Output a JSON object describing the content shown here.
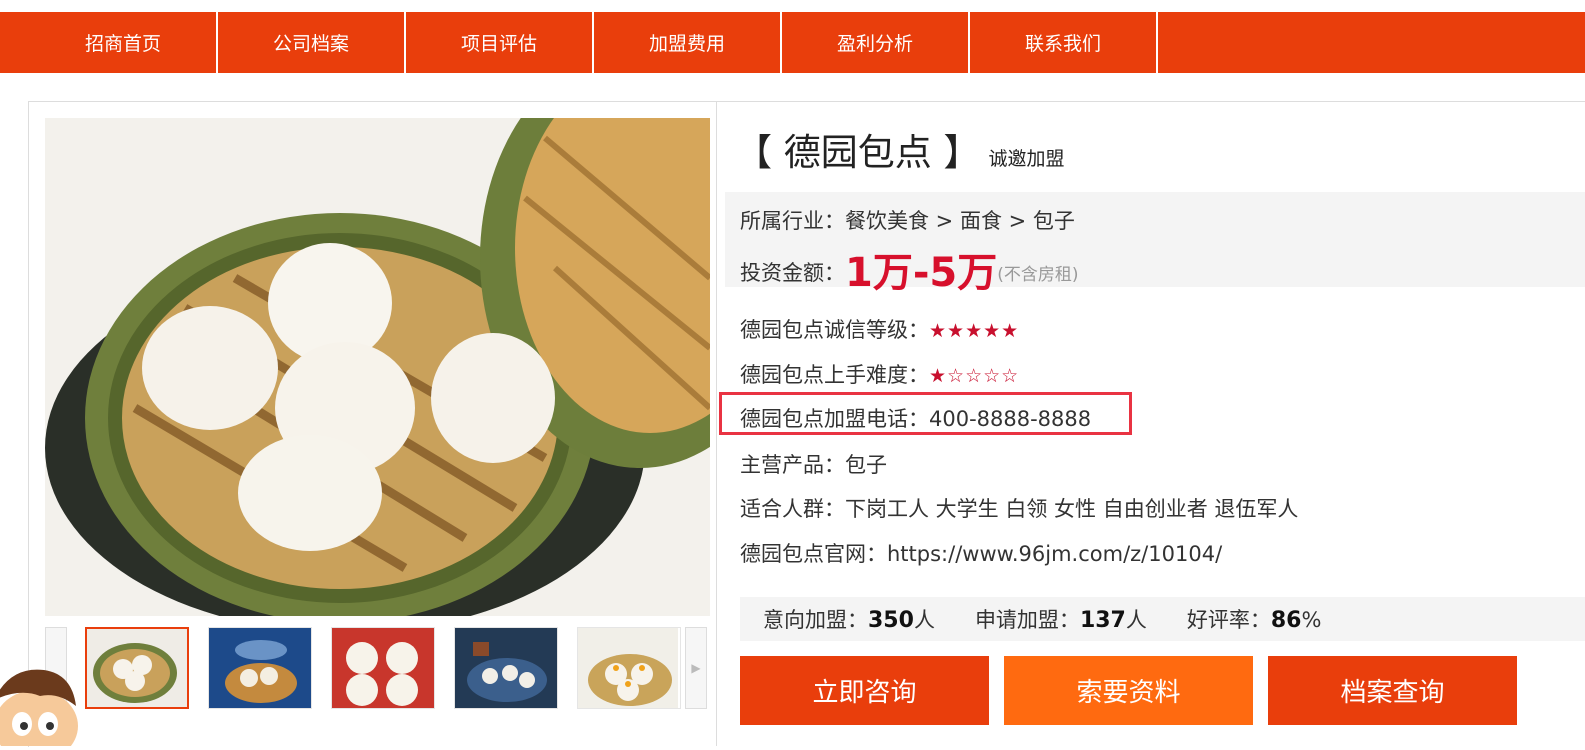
{
  "nav": {
    "items": [
      "招商首页",
      "公司档案",
      "项目评估",
      "加盟费用",
      "盈利分析",
      "联系我们"
    ]
  },
  "brand": {
    "title": "【 德园包点 】",
    "subtitle": "诚邀加盟"
  },
  "info": {
    "industry_label": "所属行业：",
    "industry_path": "餐饮美食 > 面食 > 包子",
    "investment_label": "投资金额：",
    "investment_value": "1万-5万",
    "investment_note": "(不含房租)",
    "credit_label": "德园包点诚信等级：",
    "credit_stars": 5,
    "difficulty_label": "德园包点上手难度：",
    "difficulty_stars": 1,
    "phone_label": "德园包点加盟电话：",
    "phone_value": "400-8888-8888",
    "product_label": "主营产品：",
    "product_value": "包子",
    "audience_label": "适合人群：",
    "audience_value": "下岗工人 大学生 白领 女性 自由创业者 退伍军人",
    "site_label": "德园包点官网：",
    "site_value": "https://www.96jm.com/z/10104/"
  },
  "stats": {
    "intent_label": "意向加盟：",
    "intent_value": "350",
    "intent_unit": "人",
    "apply_label": "申请加盟：",
    "apply_value": "137",
    "apply_unit": "人",
    "rating_label": "好评率：",
    "rating_value": "86",
    "rating_unit": "%"
  },
  "buttons": {
    "consult": "立即咨询",
    "materials": "索要资料",
    "archive": "档案查询"
  },
  "icons": {
    "thumb_next": "▶"
  },
  "colors": {
    "nav": "#e93e0c",
    "price": "#d7102c",
    "stars": "#c8102e",
    "btn_primary": "#e93e0c",
    "btn_secondary": "#ff6a10",
    "highlight": "#e93342"
  }
}
